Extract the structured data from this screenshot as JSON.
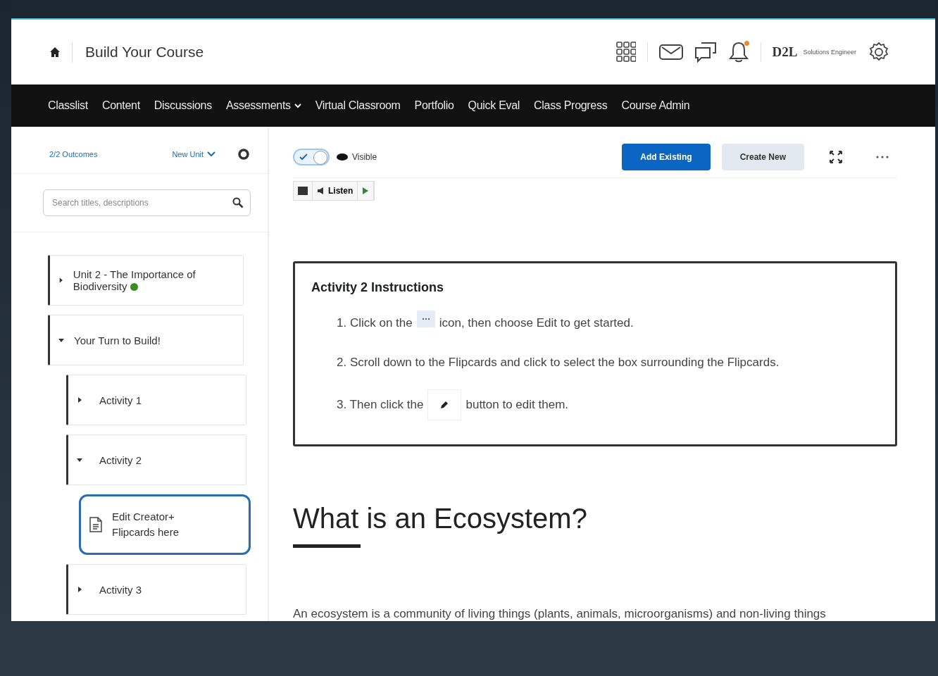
{
  "header": {
    "title": "Build Your Course",
    "brand": "D2L",
    "role": "Solutions Engineer",
    "notification_unread": true
  },
  "nav": [
    {
      "label": "Classlist",
      "has_menu": false
    },
    {
      "label": "Content",
      "has_menu": false
    },
    {
      "label": "Discussions",
      "has_menu": false
    },
    {
      "label": "Assessments",
      "has_menu": true
    },
    {
      "label": "Virtual Classroom",
      "has_menu": false
    },
    {
      "label": "Portfolio",
      "has_menu": false
    },
    {
      "label": "Quick Eval",
      "has_menu": false
    },
    {
      "label": "Class Progress",
      "has_menu": false
    },
    {
      "label": "Course Admin",
      "has_menu": false
    }
  ],
  "sidebar": {
    "outcomes": "2/2 Outcomes",
    "new_unit": "New Unit",
    "search": {
      "placeholder": "Search titles, descriptions"
    },
    "tree": [
      {
        "kind": "module",
        "title": "Unit 2 - The Importance of Biodiversity",
        "expanded": false,
        "selected": false,
        "status_dot": true
      },
      {
        "kind": "module",
        "title": "Your Turn to Build!",
        "expanded": true,
        "selected": false,
        "status_dot": false,
        "children": [
          {
            "kind": "module",
            "title": "Activity 1",
            "expanded": false,
            "selected": false,
            "status_dot": false
          },
          {
            "kind": "module",
            "title": "Activity 2",
            "expanded": true,
            "selected": false,
            "status_dot": false,
            "children": [
              {
                "kind": "topic",
                "title": "Edit Creator+ Flipcards here",
                "selected": true
              }
            ]
          },
          {
            "kind": "module",
            "title": "Activity 3",
            "expanded": false,
            "selected": false,
            "status_dot": false
          }
        ]
      }
    ]
  },
  "toolbar": {
    "visibility": {
      "on": true,
      "label": "Visible"
    },
    "add_existing": "Add Existing",
    "create_new": "Create New",
    "listen": "Listen"
  },
  "instructions": {
    "title": "Activity 2 Instructions",
    "steps": [
      [
        {
          "kind": "text",
          "text": "1. Click on the"
        },
        {
          "kind": "dots-chip"
        },
        {
          "kind": "text",
          "text": "icon, then choose Edit to get started."
        }
      ],
      [
        {
          "kind": "text",
          "text": "2. Scroll down to the Flipcards and click to select the box surrounding the Flipcards."
        }
      ],
      [
        {
          "kind": "text",
          "text": "3. Then click the"
        },
        {
          "kind": "pencil-chip"
        },
        {
          "kind": "text",
          "text": "button to edit them."
        }
      ]
    ]
  },
  "article": {
    "heading": "What is an Ecosystem?",
    "paragraph": "An ecosystem is a community of living things (plants, animals, microorganisms) and non-living things"
  }
}
